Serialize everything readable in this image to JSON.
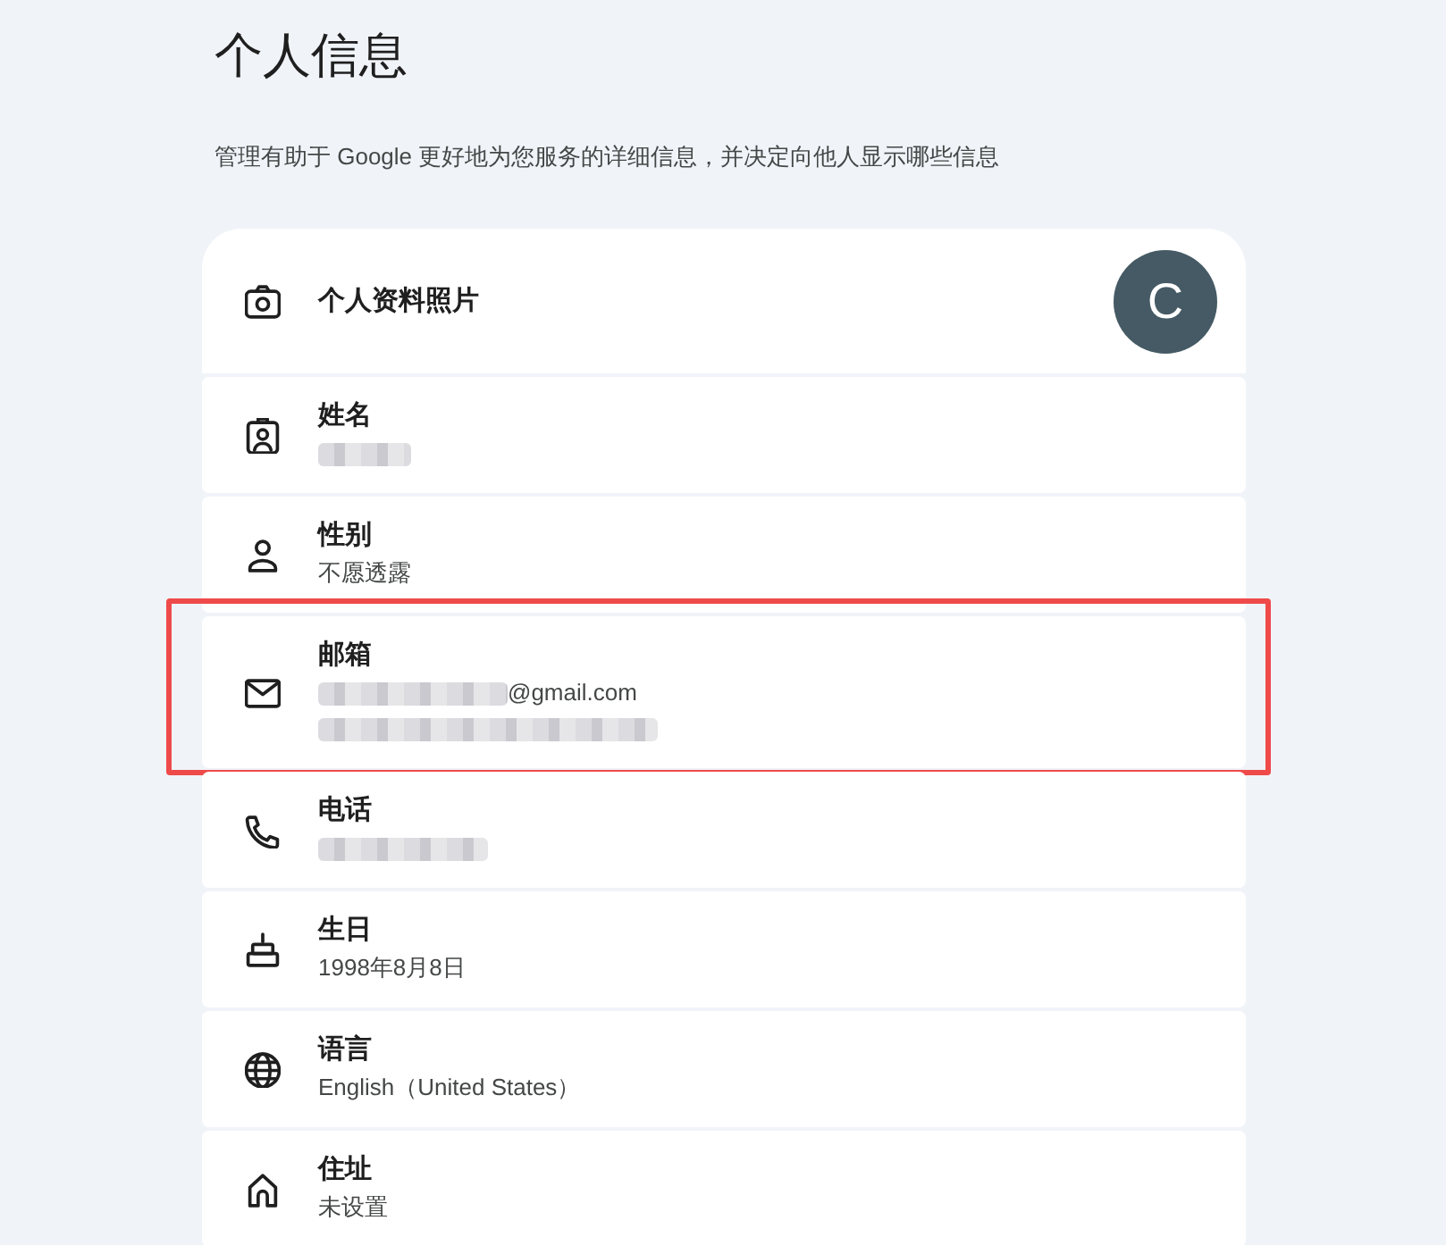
{
  "page": {
    "title": "个人信息",
    "description": "管理有助于 Google 更好地为您服务的详细信息，并决定向他人显示哪些信息"
  },
  "rows": [
    {
      "kind": "photo",
      "label": "个人资料照片",
      "avatar": "C",
      "highlighted": false
    },
    {
      "kind": "name",
      "label": "姓名",
      "lines": [
        [
          {
            "kind": "redacted"
          }
        ]
      ],
      "highlighted": false
    },
    {
      "kind": "gender",
      "label": "性别",
      "lines": [
        [
          {
            "kind": "text",
            "text": "不愿透露"
          }
        ]
      ],
      "highlighted": false
    },
    {
      "kind": "email",
      "label": "邮箱",
      "lines": [
        [
          {
            "kind": "redacted"
          },
          {
            "kind": "text",
            "text": "@gmail.com"
          }
        ],
        [
          {
            "kind": "redacted"
          }
        ]
      ],
      "highlighted": true
    },
    {
      "kind": "phone",
      "label": "电话",
      "lines": [
        [
          {
            "kind": "redacted"
          }
        ]
      ],
      "highlighted": false
    },
    {
      "kind": "birthday",
      "label": "生日",
      "lines": [
        [
          {
            "kind": "text",
            "text": "1998年8月8日"
          }
        ]
      ],
      "highlighted": false
    },
    {
      "kind": "language",
      "label": "语言",
      "lines": [
        [
          {
            "kind": "text",
            "text": "English（United States）"
          }
        ]
      ],
      "highlighted": false
    },
    {
      "kind": "address",
      "label": "住址",
      "lines": [
        [
          {
            "kind": "text",
            "text": "未设置"
          }
        ]
      ],
      "highlighted": false
    }
  ]
}
